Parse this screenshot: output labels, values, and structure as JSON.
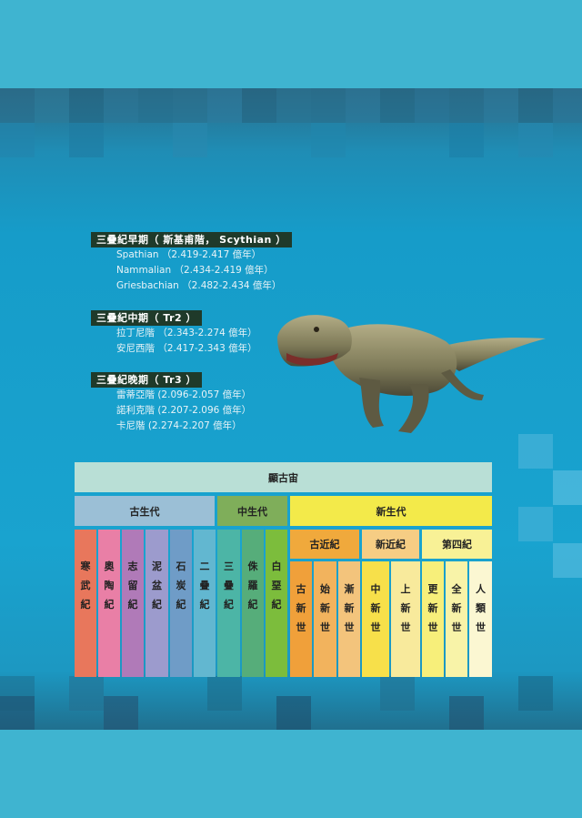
{
  "periods": [
    {
      "heading": "三疊紀早期（ 斯基甫階， Scythian ）",
      "stages": [
        "Spathian （2.419-2.417 億年）",
        "Nammalian （2.434-2.419 億年）",
        "Griesbachian （2.482-2.434 億年）"
      ]
    },
    {
      "heading": "三疊紀中期（ Tr2 ）",
      "stages": [
        "拉丁尼階 （2.343-2.274 億年）",
        "安尼西階 （2.417-2.343 億年）"
      ]
    },
    {
      "heading": "三疊紀晚期（ Tr3 ）",
      "stages": [
        "雷蒂亞階 (2.096-2.057 億年）",
        "諾利克階 (2.207-2.096 億年）",
        "卡尼階 (2.274-2.207 億年）"
      ]
    }
  ],
  "timescale": {
    "eon": "顯古宙",
    "eras": [
      "古生代",
      "中生代",
      "新生代"
    ],
    "cenozoic_periods": [
      "古近紀",
      "新近紀",
      "第四紀"
    ],
    "columns": [
      {
        "label": "寒武紀",
        "color": "#e8775c"
      },
      {
        "label": "奧陶紀",
        "color": "#e97fa6"
      },
      {
        "label": "志留紀",
        "color": "#b07ab8"
      },
      {
        "label": "泥盆紀",
        "color": "#9c9bcd"
      },
      {
        "label": "石炭紀",
        "color": "#6f9cc7"
      },
      {
        "label": "二疊紀",
        "color": "#62b7d0"
      },
      {
        "label": "三疊紀",
        "color": "#4cb5a6"
      },
      {
        "label": "侏羅紀",
        "color": "#56ad7a"
      },
      {
        "label": "白堊紀",
        "color": "#7cbd3c"
      },
      {
        "label": "古新世",
        "color": "#f0a03a"
      },
      {
        "label": "始新世",
        "color": "#f2b35d"
      },
      {
        "label": "漸新世",
        "color": "#f3c47c"
      },
      {
        "label": "中新世",
        "color": "#f7e04a"
      },
      {
        "label": "上新世",
        "color": "#f8ea9c"
      },
      {
        "label": "更新世",
        "color": "#f7ef7a"
      },
      {
        "label": "全新世",
        "color": "#f8f3a8"
      },
      {
        "label": "人類世",
        "color": "#fbf7d2"
      }
    ],
    "colors": {
      "eon": "#b9dfd6",
      "paleozoic": "#9bbfd6",
      "mesozoic": "#7fae5a",
      "cenozoic": "#f3ea4a",
      "paleogene": "#f0a93c",
      "neogene": "#f6cd84",
      "quaternary": "#f8f196"
    }
  }
}
